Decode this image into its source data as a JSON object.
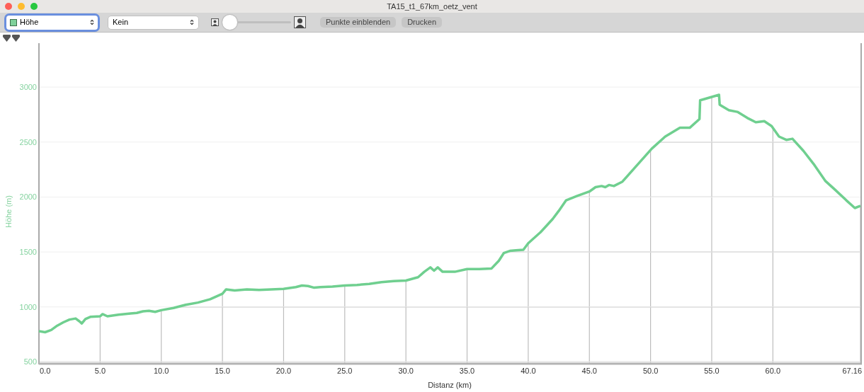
{
  "window": {
    "title": "TA15_t1_67km_oetz_vent"
  },
  "toolbar": {
    "data_select": {
      "value": "Höhe"
    },
    "second_select": {
      "value": "Kein"
    },
    "zoom_slider": {
      "level": 0.04
    },
    "buttons": [
      "Punkte einblenden",
      "Drucken"
    ]
  },
  "chart": {
    "chart_data": {
      "type": "line",
      "xlabel": "Distanz (km)",
      "ylabel": "Höhe (m)",
      "x": [
        0,
        0.5,
        1,
        1.5,
        2,
        2.5,
        3,
        3.3,
        3.5,
        3.8,
        4.2,
        5,
        5.2,
        5.6,
        6.5,
        7.5,
        8,
        8.5,
        9,
        9.5,
        10,
        11,
        12,
        13,
        14,
        15,
        15.3,
        16,
        17,
        18,
        19,
        20,
        21,
        21.5,
        22,
        22.5,
        23,
        24,
        25,
        26,
        27,
        28,
        29,
        30,
        31,
        31.5,
        32,
        32.3,
        32.6,
        33,
        34,
        35,
        36,
        37,
        37.6,
        38,
        38.5,
        39,
        39.6,
        40,
        41,
        42,
        42.5,
        43.1,
        44,
        45,
        45.5,
        46,
        46.3,
        46.6,
        47,
        47.7,
        48.9,
        50.1,
        51.2,
        52.4,
        53.2,
        54,
        54.05,
        55.6,
        55.65,
        56.4,
        57.1,
        57.9,
        58.6,
        59.3,
        59.9,
        60.5,
        61.1,
        61.6,
        62.5,
        63.4,
        64.3,
        65.1,
        66,
        66.7,
        67.16
      ],
      "series": [
        {
          "color": "#6fcf8f",
          "values": [
            780,
            770,
            790,
            830,
            860,
            885,
            895,
            870,
            850,
            890,
            910,
            915,
            935,
            915,
            930,
            940,
            945,
            960,
            965,
            955,
            970,
            990,
            1020,
            1040,
            1070,
            1120,
            1160,
            1150,
            1160,
            1155,
            1160,
            1165,
            1180,
            1195,
            1190,
            1175,
            1180,
            1185,
            1195,
            1200,
            1210,
            1225,
            1235,
            1240,
            1270,
            1320,
            1360,
            1330,
            1360,
            1320,
            1320,
            1345,
            1345,
            1350,
            1420,
            1490,
            1510,
            1515,
            1520,
            1580,
            1680,
            1800,
            1875,
            1970,
            2010,
            2050,
            2090,
            2100,
            2090,
            2110,
            2100,
            2140,
            2290,
            2440,
            2550,
            2630,
            2630,
            2710,
            2880,
            2930,
            2840,
            2790,
            2775,
            2720,
            2680,
            2690,
            2645,
            2550,
            2520,
            2530,
            2420,
            2290,
            2145,
            2065,
            1970,
            1900,
            1920
          ]
        }
      ],
      "xlim": [
        0,
        67.16
      ],
      "ylim": [
        490,
        3400
      ],
      "xticks": [
        {
          "value": 0,
          "label": "0.0"
        },
        {
          "value": 5,
          "label": "5.0"
        },
        {
          "value": 10,
          "label": "10.0"
        },
        {
          "value": 15,
          "label": "15.0"
        },
        {
          "value": 20,
          "label": "20.0"
        },
        {
          "value": 25,
          "label": "25.0"
        },
        {
          "value": 30,
          "label": "30.0"
        },
        {
          "value": 35,
          "label": "35.0"
        },
        {
          "value": 40,
          "label": "40.0"
        },
        {
          "value": 45,
          "label": "45.0"
        },
        {
          "value": 50,
          "label": "50.0"
        },
        {
          "value": 55,
          "label": "55.0"
        },
        {
          "value": 60,
          "label": "60.0"
        },
        {
          "value": 67.16,
          "label": "67.16"
        }
      ],
      "yticks": [
        500,
        1000,
        1500,
        2000,
        2500,
        3000
      ],
      "grid": true
    }
  }
}
